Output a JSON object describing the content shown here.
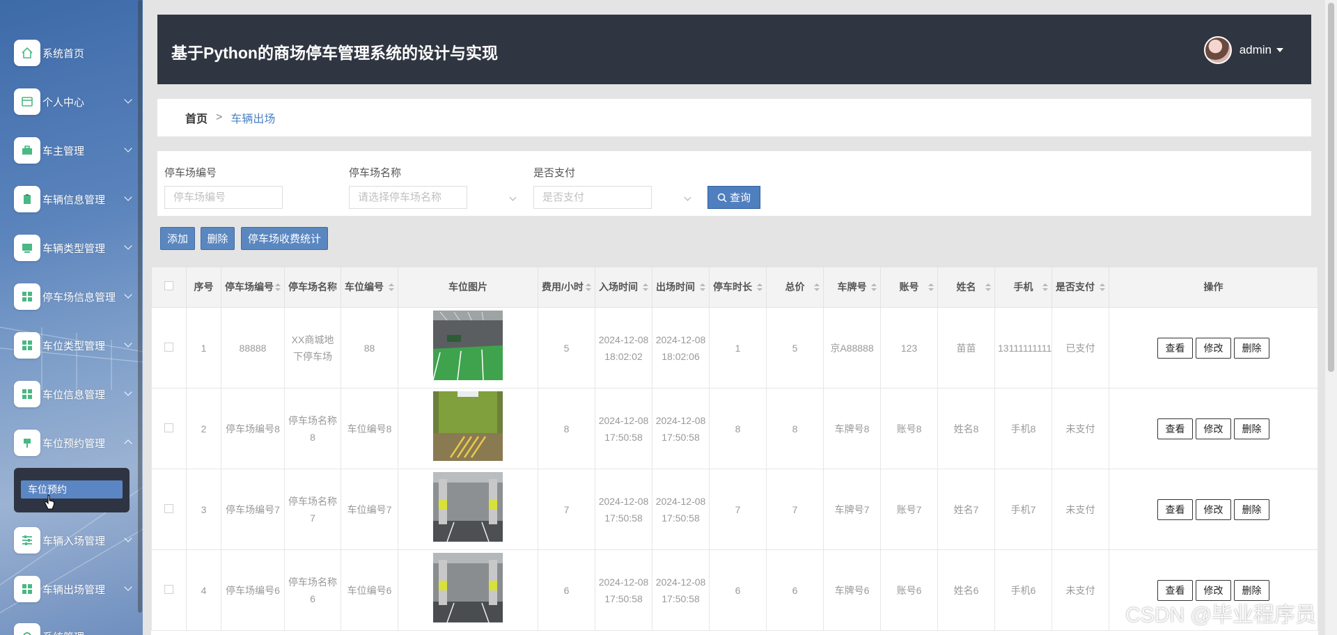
{
  "app": {
    "title": "基于Python的商场停车管理系统的设计与实现",
    "username": "admin"
  },
  "sidebar": {
    "items": [
      {
        "label": "系统首页",
        "icon": "home-icon"
      },
      {
        "label": "个人中心",
        "icon": "id-card-icon"
      },
      {
        "label": "车主管理",
        "icon": "briefcase-icon"
      },
      {
        "label": "车辆信息管理",
        "icon": "clipboard-icon"
      },
      {
        "label": "车辆类型管理",
        "icon": "monitor-icon"
      },
      {
        "label": "停车场信息管理",
        "icon": "grid-icon"
      },
      {
        "label": "车位类型管理",
        "icon": "grid-icon"
      },
      {
        "label": "车位信息管理",
        "icon": "grid-icon"
      },
      {
        "label": "车位预约管理",
        "icon": "pin-icon"
      },
      {
        "label": "车辆入场管理",
        "icon": "sliders-icon"
      },
      {
        "label": "车辆出场管理",
        "icon": "grid-icon"
      },
      {
        "label": "系统管理",
        "icon": "gear-icon"
      }
    ],
    "submenu_label": "车位预约"
  },
  "breadcrumb": {
    "home": "首页",
    "separator": ">",
    "current": "车辆出场"
  },
  "search": {
    "lot_no_label": "停车场编号",
    "lot_no_placeholder": "停车场编号",
    "lot_name_label": "停车场名称",
    "lot_name_placeholder": "请选择停车场名称",
    "paid_label": "是否支付",
    "paid_placeholder": "是否支付",
    "query_label": "查询"
  },
  "actions": {
    "add": "添加",
    "delete": "删除",
    "stats": "停车场收费统计"
  },
  "table": {
    "headers": [
      "序号",
      "停车场编号",
      "停车场名称",
      "车位编号",
      "车位图片",
      "费用/小时",
      "入场时间",
      "出场时间",
      "停车时长",
      "总价",
      "车牌号",
      "账号",
      "姓名",
      "手机",
      "是否支付",
      "操作"
    ],
    "buttons": {
      "view": "查看",
      "edit": "修改",
      "delete": "删除"
    },
    "rows": [
      {
        "no": "1",
        "lot_no": "88888",
        "lot_name": "XX商城地下停车场",
        "space_no": "88",
        "fee": "5",
        "in_time": "2024-12-08 18:02:02",
        "out_time": "2024-12-08 18:02:06",
        "duration": "1",
        "total": "5",
        "plate": "京A88888",
        "account": "123",
        "name": "苗苗",
        "phone": "13111111111",
        "paid": "已支付"
      },
      {
        "no": "2",
        "lot_no": "停车场编号8",
        "lot_name": "停车场名称8",
        "space_no": "车位编号8",
        "fee": "8",
        "in_time": "2024-12-08 17:50:58",
        "out_time": "2024-12-08 17:50:58",
        "duration": "8",
        "total": "8",
        "plate": "车牌号8",
        "account": "账号8",
        "name": "姓名8",
        "phone": "手机8",
        "paid": "未支付"
      },
      {
        "no": "3",
        "lot_no": "停车场编号7",
        "lot_name": "停车场名称7",
        "space_no": "车位编号7",
        "fee": "7",
        "in_time": "2024-12-08 17:50:58",
        "out_time": "2024-12-08 17:50:58",
        "duration": "7",
        "total": "7",
        "plate": "车牌号7",
        "account": "账号7",
        "name": "姓名7",
        "phone": "手机7",
        "paid": "未支付"
      },
      {
        "no": "4",
        "lot_no": "停车场编号6",
        "lot_name": "停车场名称6",
        "space_no": "车位编号6",
        "fee": "6",
        "in_time": "2024-12-08 17:50:58",
        "out_time": "2024-12-08 17:50:58",
        "duration": "6",
        "total": "6",
        "plate": "车牌号6",
        "account": "账号6",
        "name": "姓名6",
        "phone": "手机6",
        "paid": "未支付"
      }
    ]
  },
  "watermark": "CSDN @毕业程序员",
  "colors": {
    "header_bg": "#303641",
    "accent": "#4f7fbf",
    "link": "#4a82c4"
  }
}
